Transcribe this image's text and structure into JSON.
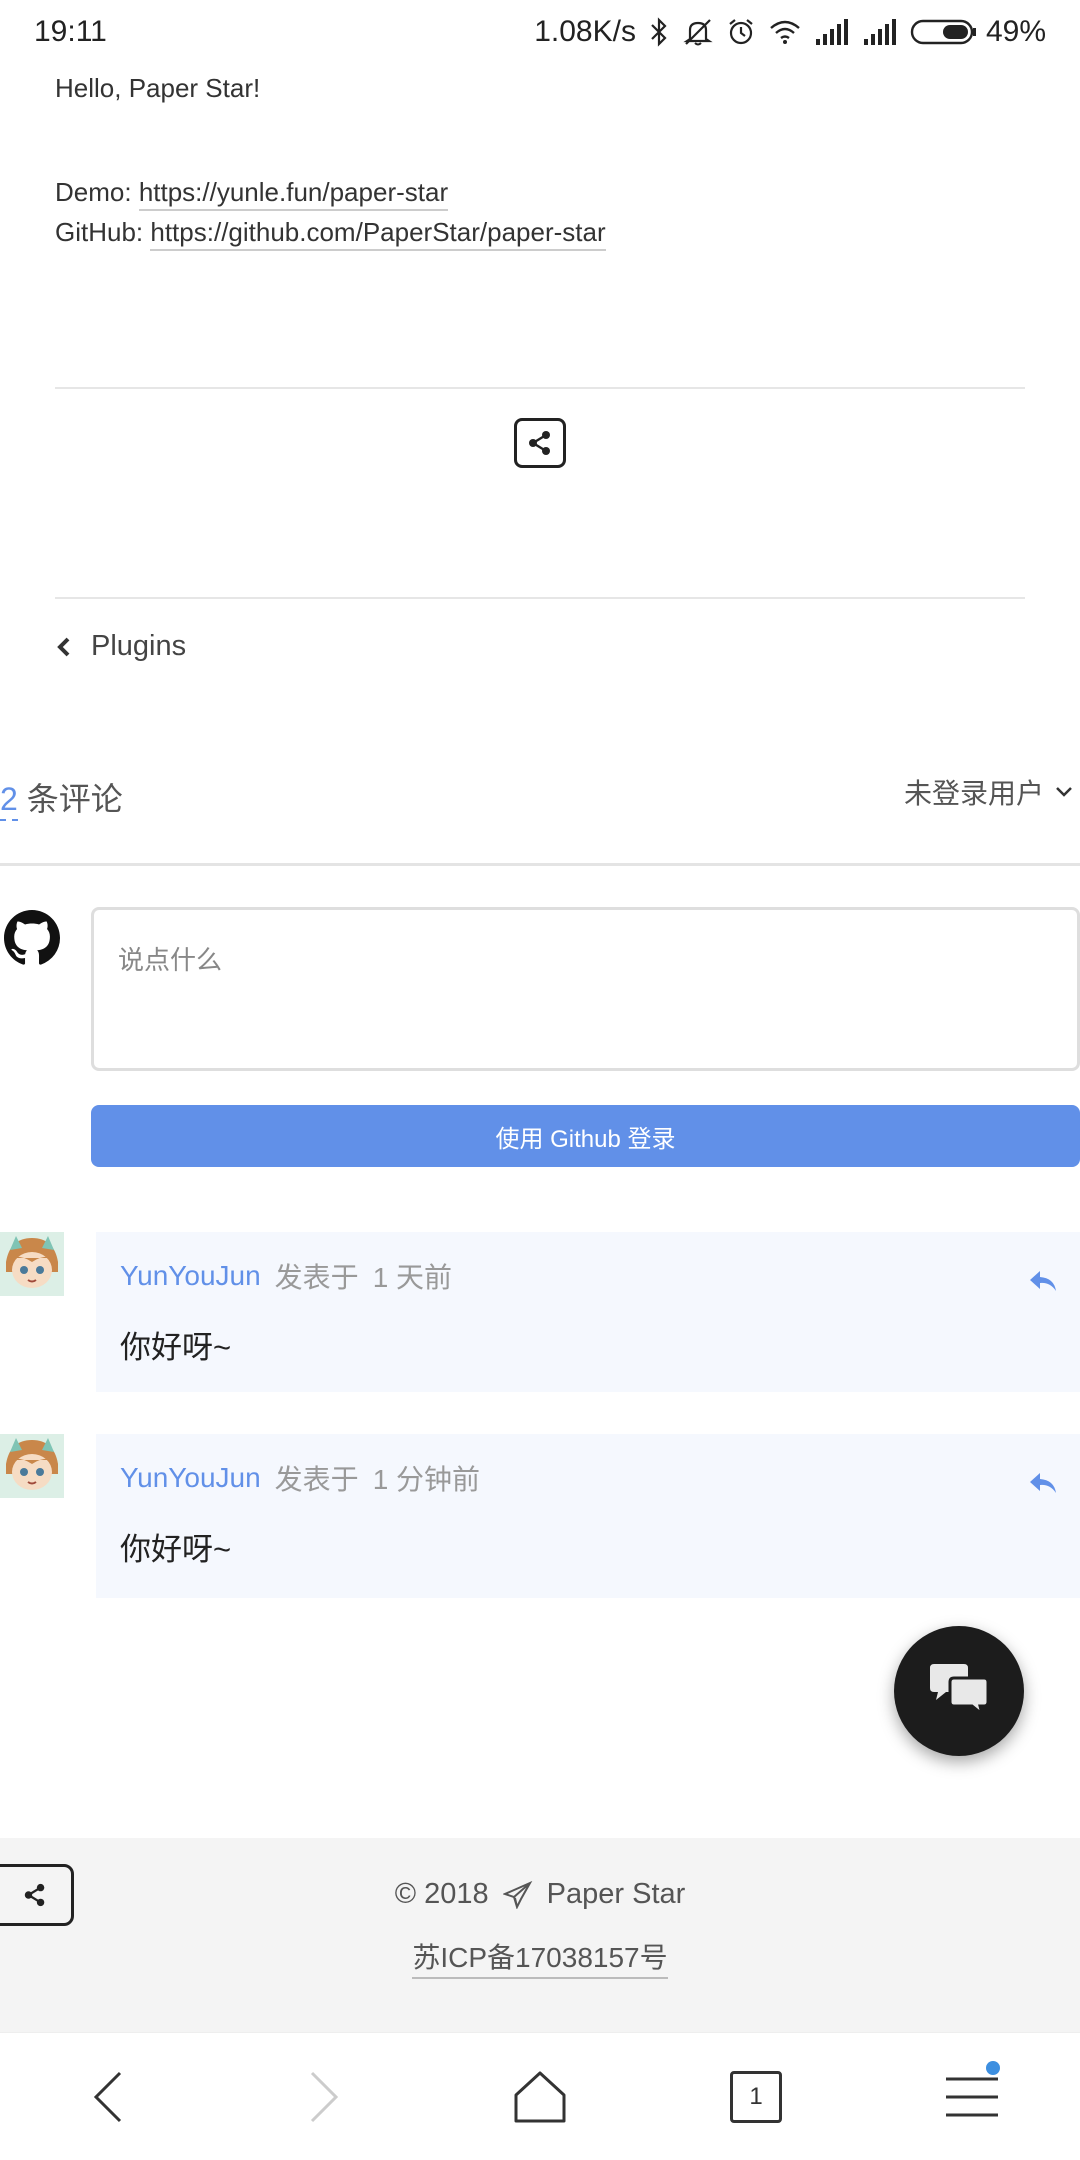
{
  "status": {
    "time": "19:11",
    "speed": "1.08K/s",
    "battery": "49%"
  },
  "article": {
    "hello": "Hello, Paper Star!",
    "demo_label": "Demo: ",
    "demo_url": "https://yunle.fun/paper-star",
    "github_label": "GitHub: ",
    "github_url": "https://github.com/PaperStar/paper-star"
  },
  "nav": {
    "prev_label": "Plugins"
  },
  "comments": {
    "count": "2",
    "count_suffix": " 条评论",
    "user_menu": "未登录用户",
    "input_placeholder": "说点什么",
    "login_button": "使用 Github 登录",
    "items": [
      {
        "author": "YunYouJun",
        "published_label": "发表于",
        "time": "1 天前",
        "body": "你好呀~"
      },
      {
        "author": "YunYouJun",
        "published_label": "发表于",
        "time": "1 分钟前",
        "body": "你好呀~"
      }
    ]
  },
  "footer": {
    "copyright": "© 2018",
    "site_name": "Paper Star",
    "icp": "苏ICP备17038157号"
  },
  "browser": {
    "tab_count": "1"
  },
  "colors": {
    "accent": "#6190e8",
    "comment_bg": "#f5f8fe",
    "footer_bg": "#f4f4f4"
  },
  "icons": [
    "bluetooth-icon",
    "mute-icon",
    "alarm-icon",
    "wifi-icon",
    "signal-icon",
    "battery-icon",
    "share-icon",
    "chevron-left-icon",
    "chevron-down-icon",
    "github-icon",
    "reply-icon",
    "chat-icon",
    "paper-plane-icon",
    "back-icon",
    "forward-icon",
    "home-icon",
    "menu-icon"
  ]
}
